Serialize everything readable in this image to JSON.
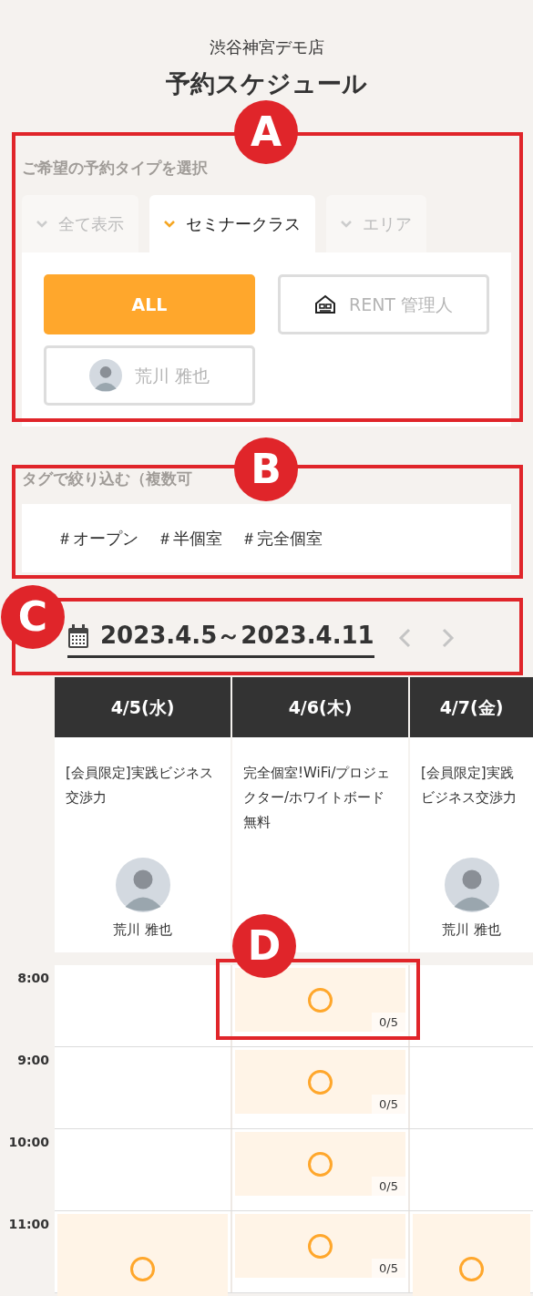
{
  "shop_name": "渋谷神宮デモ店",
  "page_title": "予約スケジュール",
  "type_section": {
    "label": "ご希望の予約タイプを選択",
    "tabs": [
      {
        "label": "全て表示",
        "selected": false
      },
      {
        "label": "セミナークラス",
        "selected": true
      },
      {
        "label": "エリア",
        "selected": false
      }
    ],
    "options": [
      {
        "label": "ALL",
        "kind": "plain",
        "selected": true
      },
      {
        "label": "RENT 管理人",
        "kind": "house",
        "selected": false
      },
      {
        "label": "荒川 雅也",
        "kind": "avatar",
        "selected": false
      }
    ]
  },
  "tag_section": {
    "label": "タグで絞り込む（複数可",
    "tags": [
      "＃オープン",
      "＃半個室",
      "＃完全個室"
    ]
  },
  "date_range": "2023.4.5～2023.4.11",
  "days": [
    {
      "date": "4/5(水)",
      "title": "[会員限定]実践ビジネス交渉力",
      "host": "荒川 雅也"
    },
    {
      "date": "4/6(木)",
      "title": "完全個室!WiFi/プロジェクター/ホワイトボード無料"
    },
    {
      "date": "4/7(金)",
      "title": "[会員限定]実践ビジネス交渉力",
      "host": "荒川 雅也"
    }
  ],
  "time_rows": [
    {
      "time": "8:00",
      "cells": [
        {
          "kind": "empty"
        },
        {
          "kind": "slot",
          "count": "0/5"
        },
        {
          "kind": "empty"
        }
      ]
    },
    {
      "time": "9:00",
      "cells": [
        {
          "kind": "empty"
        },
        {
          "kind": "slot",
          "count": "0/5"
        },
        {
          "kind": "empty"
        }
      ]
    },
    {
      "time": "10:00",
      "cells": [
        {
          "kind": "empty"
        },
        {
          "kind": "slot",
          "count": "0/5"
        },
        {
          "kind": "empty"
        }
      ]
    },
    {
      "time": "11:00",
      "cells": [
        {
          "kind": "long_slot"
        },
        {
          "kind": "slot",
          "count": "0/5"
        },
        {
          "kind": "long_slot"
        }
      ]
    }
  ],
  "callouts": [
    "A",
    "B",
    "C",
    "D"
  ]
}
